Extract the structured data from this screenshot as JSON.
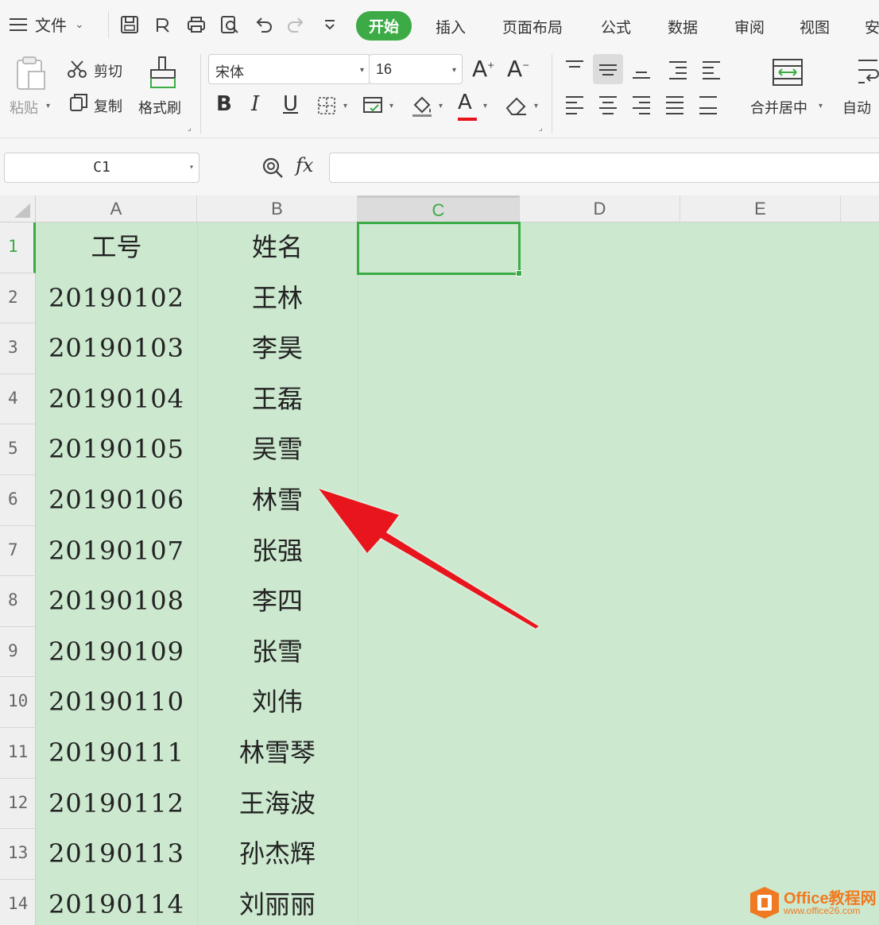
{
  "menubar": {
    "file_label": "文件",
    "tabs": [
      "开始",
      "插入",
      "页面布局",
      "公式",
      "数据",
      "审阅",
      "视图",
      "安"
    ]
  },
  "ribbon": {
    "paste_label": "粘贴",
    "cut_label": "剪切",
    "copy_label": "复制",
    "format_painter_label": "格式刷",
    "font_name": "宋体",
    "font_size": "16",
    "merge_label": "合并居中",
    "autowrap_label": "自动"
  },
  "formula_bar": {
    "name_box": "C1",
    "fx_label": "fx",
    "formula": ""
  },
  "sheet": {
    "column_headers": [
      "A",
      "B",
      "C",
      "D",
      "E"
    ],
    "selected_column": "C",
    "selected_row": "1",
    "active_cell": "C1",
    "rows": [
      {
        "row": "1",
        "a": "工号",
        "b": "姓名"
      },
      {
        "row": "2",
        "a": "20190102",
        "b": "王林"
      },
      {
        "row": "3",
        "a": "20190103",
        "b": "李昊"
      },
      {
        "row": "4",
        "a": "20190104",
        "b": "王磊"
      },
      {
        "row": "5",
        "a": "20190105",
        "b": "吴雪"
      },
      {
        "row": "6",
        "a": "20190106",
        "b": "林雪"
      },
      {
        "row": "7",
        "a": "20190107",
        "b": "张强"
      },
      {
        "row": "8",
        "a": "20190108",
        "b": "李四"
      },
      {
        "row": "9",
        "a": "20190109",
        "b": "张雪"
      },
      {
        "row": "10",
        "a": "20190110",
        "b": "刘伟"
      },
      {
        "row": "11",
        "a": "20190111",
        "b": "林雪琴"
      },
      {
        "row": "12",
        "a": "20190112",
        "b": "王海波"
      },
      {
        "row": "13",
        "a": "20190113",
        "b": "孙杰辉"
      },
      {
        "row": "14",
        "a": "20190114",
        "b": "刘丽丽"
      }
    ]
  },
  "watermark": {
    "title": "Office教程网",
    "url": "www.office26.com"
  },
  "colors": {
    "accent": "#3cab46",
    "sheet_background": "#cce8cf",
    "arrow": "#e8141b",
    "watermark": "#f07a21"
  }
}
